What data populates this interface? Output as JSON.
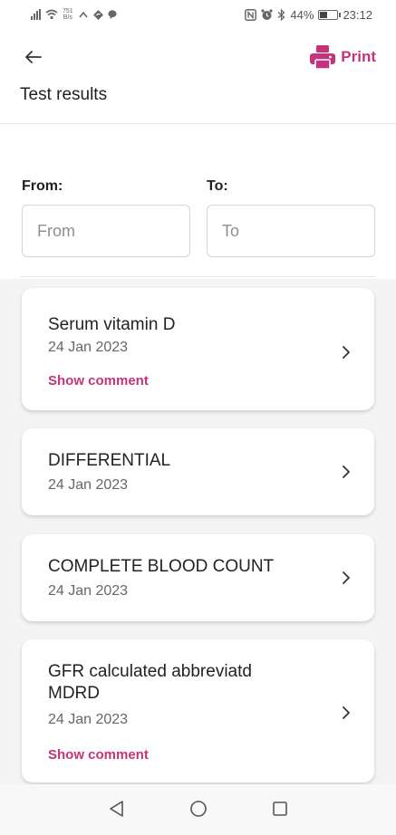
{
  "status_bar": {
    "net_speed_value": "751",
    "net_speed_unit": "B/s",
    "battery_percent": "44%",
    "battery_level": 0.44,
    "time": "23:12"
  },
  "header": {
    "print_label": "Print",
    "title": "Test results"
  },
  "filter": {
    "from_label": "From:",
    "to_label": "To:",
    "from_placeholder": "From",
    "to_placeholder": "To"
  },
  "results": [
    {
      "name": "Serum vitamin D",
      "date": "24 Jan 2023",
      "comment_label": "Show comment"
    },
    {
      "name": "DIFFERENTIAL",
      "date": "24 Jan 2023"
    },
    {
      "name": "COMPLETE BLOOD COUNT",
      "date": "24 Jan 2023"
    },
    {
      "name": "GFR calculated abbreviatd MDRD",
      "date": "24 Jan 2023",
      "comment_label": "Show comment"
    }
  ],
  "colors": {
    "accent": "#c5337d",
    "list_background": "#f4f4f5"
  },
  "icons": {
    "back": "arrow-left-icon",
    "print": "printer-icon",
    "chevron": "chevron-right-icon",
    "nav_back": "triangle-back-icon",
    "nav_home": "circle-home-icon",
    "nav_recents": "square-recents-icon"
  }
}
